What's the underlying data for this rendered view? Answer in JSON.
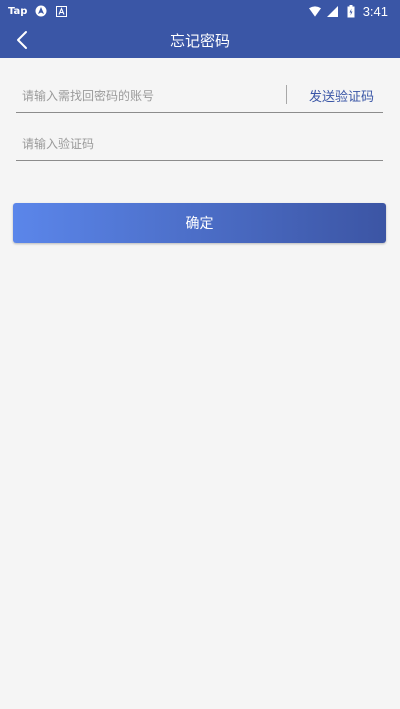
{
  "status_bar": {
    "app_label": "Tap",
    "time": "3:41",
    "icons": [
      "navigation-icon",
      "a-icon",
      "wifi-icon",
      "signal-icon",
      "battery-icon"
    ]
  },
  "header": {
    "title": "忘记密码",
    "back_icon": "chevron-left-icon"
  },
  "form": {
    "account_placeholder": "请输入需找回密码的账号",
    "account_value": "",
    "send_code_label": "发送验证码",
    "code_placeholder": "请输入验证码",
    "code_value": ""
  },
  "confirm_label": "确定",
  "colors": {
    "primary": "#3a56a6",
    "gradient_start": "#5b86ea",
    "gradient_end": "#3c55a4",
    "background": "#f5f5f5"
  }
}
